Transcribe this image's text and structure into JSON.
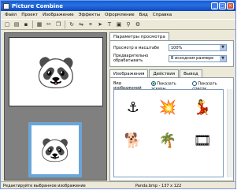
{
  "window": {
    "title": "Picture Combine"
  },
  "menu": [
    "Файл",
    "Проект",
    "Изображение",
    "Эффекты",
    "Оформление",
    "Вид",
    "Справка"
  ],
  "toolbar_icons": [
    "new-icon",
    "open-icon",
    "save-icon",
    "print-icon",
    "cut-icon",
    "copy-icon",
    "paste-icon",
    "rotate-icon",
    "flip-icon",
    "crop-icon",
    "arrow-icon",
    "text-icon",
    "image-icon",
    "zoom-icon",
    "settings-icon"
  ],
  "left": {
    "image1_alt": "🐼",
    "image2_alt": "🐼"
  },
  "tabs_top": [
    "Параметры просмотра"
  ],
  "view": {
    "zoom_label": "Просмотр в масштабе",
    "zoom_value": "100%",
    "pre_label": "Предварительно обрабатывать",
    "pre_value": "В исходном размере"
  },
  "tabs_bottom": [
    "Изображения",
    "Действия",
    "Вывод"
  ],
  "images": {
    "view_label": "Вид изображений",
    "radio1": "Показать эскизы",
    "radio2": "Показать список",
    "cells": [
      "⚓",
      "💥",
      "💃",
      "🐕",
      "🌴",
      "🎞"
    ]
  },
  "status": {
    "left": "Редактируйте выбранное изображение",
    "right": "Panda.bmp - 137 x 122"
  }
}
